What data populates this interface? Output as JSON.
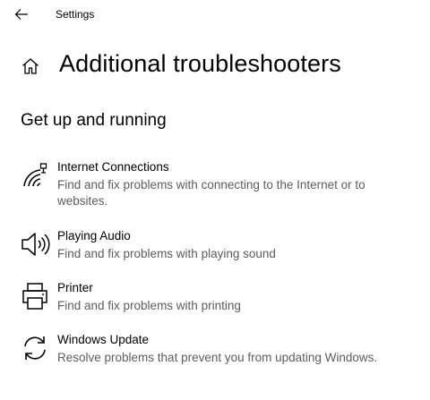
{
  "app": {
    "title": "Settings",
    "back_icon": "back-arrow-icon",
    "home_icon": "home-icon"
  },
  "page": {
    "title": "Additional troubleshooters"
  },
  "section": {
    "title": "Get up and running"
  },
  "troubleshooters": [
    {
      "title": "Internet Connections",
      "description": "Find and fix problems with connecting to the Internet or to websites.",
      "icon": "network-icon"
    },
    {
      "title": "Playing Audio",
      "description": "Find and fix problems with playing sound",
      "icon": "speaker-icon"
    },
    {
      "title": "Printer",
      "description": "Find and fix problems with printing",
      "icon": "printer-icon"
    },
    {
      "title": "Windows Update",
      "description": "Resolve problems that prevent you from updating Windows.",
      "icon": "refresh-icon"
    }
  ]
}
